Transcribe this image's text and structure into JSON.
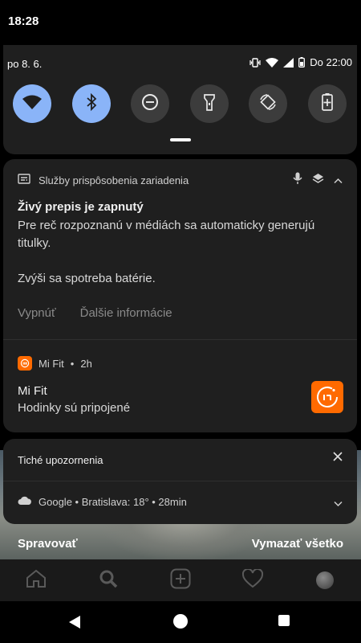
{
  "status_bar": {
    "time": "18:28"
  },
  "quick_settings": {
    "date": "po 8. 6.",
    "alarm": "Do 22:00",
    "tiles": [
      "wifi",
      "bluetooth",
      "do-not-disturb",
      "flashlight",
      "auto-rotate",
      "battery-saver"
    ],
    "active_tiles": [
      "wifi",
      "bluetooth"
    ],
    "accent_color": "#8ab4f8"
  },
  "notification_live_caption": {
    "app": "Služby prispôsobenia zariadenia",
    "title": "Živý prepis je zapnutý",
    "text": "Pre reč rozpoznanú v médiách sa automaticky generujú titulky.",
    "text2": "Zvýši sa spotreba batérie.",
    "action_off": "Vypnúť",
    "action_more": "Ďalšie informácie"
  },
  "notification_mifit": {
    "app": "Mi Fit",
    "time": "2h",
    "title": "Mi Fit",
    "text": "Hodinky sú pripojené",
    "brand_color": "#ff6a00"
  },
  "silent": {
    "heading": "Tiché upozornenia",
    "google": "Google • Bratislava: 18° • 28min"
  },
  "shade_actions": {
    "manage": "Spravovať",
    "clear_all": "Vymazať všetko"
  },
  "app_nav": [
    "home",
    "search",
    "add",
    "heart",
    "profile"
  ]
}
